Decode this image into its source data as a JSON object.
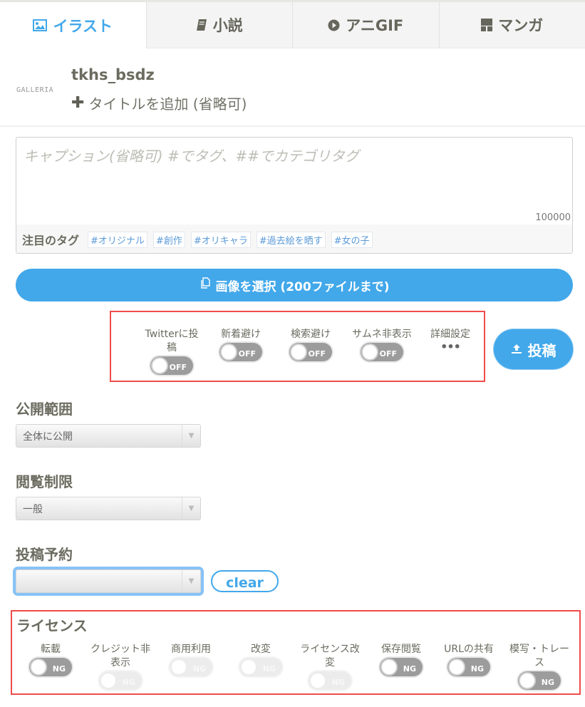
{
  "tabs": [
    {
      "label": "イラスト",
      "icon": "image-icon",
      "active": true
    },
    {
      "label": "小説",
      "icon": "book-icon",
      "active": false
    },
    {
      "label": "アニGIF",
      "icon": "play-circle-icon",
      "active": false
    },
    {
      "label": "マンガ",
      "icon": "manga-panels-icon",
      "active": false
    }
  ],
  "header": {
    "logo": "GALLERIA",
    "username": "tkhs_bsdz",
    "add_title": "タイトルを追加 (省略可)"
  },
  "caption": {
    "placeholder": "キャプション(省略可) #でタグ、##でカテゴリタグ",
    "value": "",
    "char_count": "100000",
    "tags_label": "注目のタグ",
    "tags": [
      "#オリジナル",
      "#創作",
      "#オリキャラ",
      "#過去絵を晒す",
      "#女の子"
    ]
  },
  "select_images": {
    "label": "画像を選択 (200ファイルまで)"
  },
  "options": {
    "twitter": {
      "label_line1": "Twitterに投",
      "label_line2": "稿",
      "state": "OFF"
    },
    "new_avoid": {
      "label": "新着避け",
      "state": "OFF"
    },
    "search_avoid": {
      "label": "検索避け",
      "state": "OFF"
    },
    "thumb_hide": {
      "label": "サムネ非表示",
      "state": "OFF"
    },
    "details": {
      "label": "詳細設定",
      "more": "•••"
    }
  },
  "post_button": {
    "label": "投稿"
  },
  "visibility": {
    "title": "公開範囲",
    "selected": "全体に公開"
  },
  "restriction": {
    "title": "閲覧制限",
    "selected": "一般"
  },
  "schedule": {
    "title": "投稿予約",
    "selected": "",
    "clear_label": "clear"
  },
  "license": {
    "title": "ライセンス",
    "items": [
      {
        "line1": "転載",
        "line2": "",
        "state": "NG",
        "enabled": true
      },
      {
        "line1": "クレジット非",
        "line2": "表示",
        "state": "NG",
        "enabled": false
      },
      {
        "line1": "商用利用",
        "line2": "",
        "state": "NG",
        "enabled": false
      },
      {
        "line1": "改変",
        "line2": "",
        "state": "NG",
        "enabled": false
      },
      {
        "line1": "ライセンス改",
        "line2": "変",
        "state": "NG",
        "enabled": false
      },
      {
        "line1": "保存閲覧",
        "line2": "",
        "state": "NG",
        "enabled": true
      },
      {
        "line1": "URLの共有",
        "line2": "",
        "state": "NG",
        "enabled": true
      },
      {
        "line1": "模写・トレー",
        "line2": "ス",
        "state": "NG",
        "enabled": true
      }
    ]
  },
  "colors": {
    "accent": "#42a8ea",
    "highlight_border": "#f04b4b",
    "toggle_off": "#9c9c9c"
  }
}
